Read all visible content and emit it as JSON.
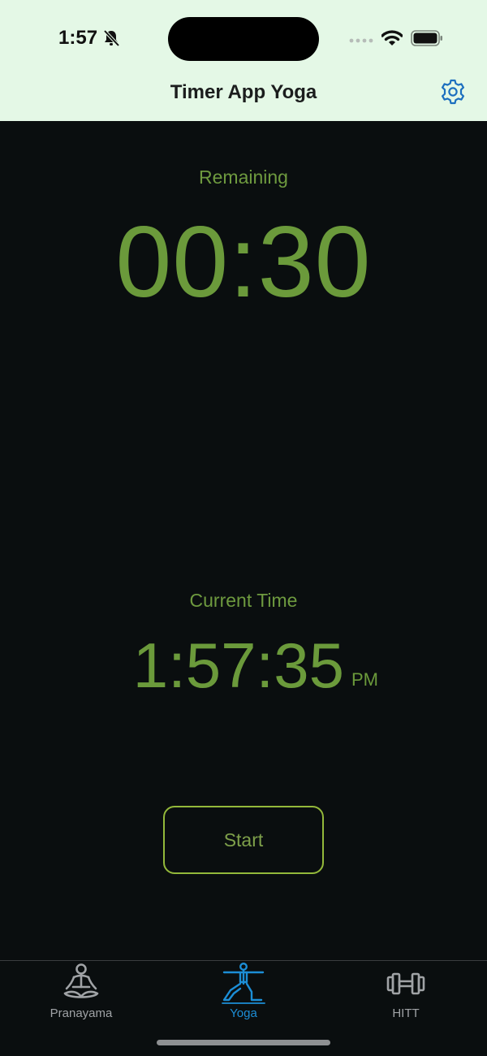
{
  "status_bar": {
    "time": "1:57",
    "icons": [
      "bell-slash-icon",
      "cellular-signal-icon",
      "wifi-icon",
      "battery-icon"
    ]
  },
  "nav": {
    "title": "Timer App Yoga",
    "settings_icon": "gear-icon"
  },
  "timer": {
    "remaining_label": "Remaining",
    "remaining_value": "00:30"
  },
  "clock": {
    "label": "Current Time",
    "time": "1:57:35",
    "ampm": "PM"
  },
  "actions": {
    "start_label": "Start"
  },
  "tabs": [
    {
      "label": "Pranayama",
      "icon": "meditation-figure-icon",
      "active": false
    },
    {
      "label": "Yoga",
      "icon": "yoga-warrior-pose-icon",
      "active": true
    },
    {
      "label": "HITT",
      "icon": "dumbbell-icon",
      "active": false
    }
  ],
  "colors": {
    "header_bg": "#e4f8e6",
    "content_bg": "#0a0e0f",
    "accent_green": "#6b9a3b",
    "button_border": "#93b83a",
    "tab_active": "#1c8ed6",
    "tab_inactive": "#a0a3a6"
  }
}
